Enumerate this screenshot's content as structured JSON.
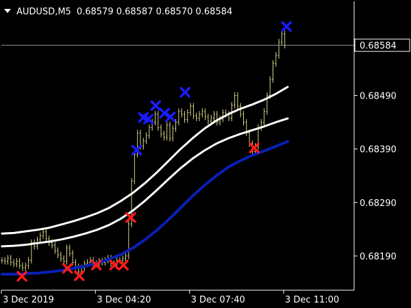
{
  "header": {
    "symbol": "AUDUSD,M5",
    "ohlc": "0.68579 0.68587 0.68570 0.68584"
  },
  "chart_data": {
    "type": "line",
    "title": "AUDUSD,M5  0.68579 0.68587 0.68570 0.68584",
    "current_price": 0.68584,
    "current_price_label": "0.68584",
    "ylim": [
      0.68126,
      0.68666
    ],
    "y_ticks": [
      {
        "value": 0.6849,
        "label": "0.68490"
      },
      {
        "value": 0.6839,
        "label": "0.68390"
      },
      {
        "value": 0.6829,
        "label": "0.68290"
      },
      {
        "value": 0.6819,
        "label": "0.68190"
      }
    ],
    "xlim": [
      0,
      120
    ],
    "x_ticks": [
      {
        "value": 0,
        "label": "3 Dec 2019"
      },
      {
        "value": 32,
        "label": "3 Dec 04:20"
      },
      {
        "value": 64,
        "label": "3 Dec 07:40"
      },
      {
        "value": 96,
        "label": "3 Dec 11:00"
      }
    ],
    "price_close": [
      0.68182,
      0.6818,
      0.68186,
      0.68178,
      0.68175,
      0.6818,
      0.68172,
      0.68168,
      0.68172,
      0.68182,
      0.68215,
      0.68208,
      0.6822,
      0.68228,
      0.68235,
      0.68222,
      0.68215,
      0.6821,
      0.682,
      0.68192,
      0.68185,
      0.6818,
      0.68205,
      0.68195,
      0.68178,
      0.6817,
      0.6816,
      0.68168,
      0.68175,
      0.68178,
      0.68182,
      0.68176,
      0.68175,
      0.6818,
      0.68178,
      0.68182,
      0.68186,
      0.68176,
      0.68176,
      0.68182,
      0.68182,
      0.68185,
      0.6819,
      0.6825,
      0.6833,
      0.6838,
      0.6842,
      0.68395,
      0.68405,
      0.68415,
      0.6843,
      0.6844,
      0.68455,
      0.6843,
      0.68418,
      0.68412,
      0.68435,
      0.6841,
      0.68428,
      0.6844,
      0.6846,
      0.68455,
      0.68445,
      0.68458,
      0.6847,
      0.68452,
      0.68448,
      0.68455,
      0.6846,
      0.6845,
      0.68442,
      0.68448,
      0.68455,
      0.6844,
      0.68446,
      0.68458,
      0.68455,
      0.68448,
      0.68472,
      0.6849,
      0.6847,
      0.68455,
      0.6844,
      0.6842,
      0.684,
      0.68385,
      0.68395,
      0.6843,
      0.6844,
      0.6846,
      0.6849,
      0.6852,
      0.6855,
      0.68565,
      0.6859,
      0.68605,
      0.68584
    ],
    "series": [
      {
        "color": "#ffffff",
        "values": [
          0.68232,
          0.68233,
          0.68236,
          0.68239,
          0.68243,
          0.68249,
          0.68255,
          0.68262,
          0.6827,
          0.6828,
          0.68293,
          0.68308,
          0.68326,
          0.68346,
          0.68368,
          0.6839,
          0.6841,
          0.68428,
          0.68443,
          0.68455,
          0.68465,
          0.68473,
          0.68482,
          0.68493,
          0.68506
        ]
      },
      {
        "color": "#ffffff",
        "values": [
          0.68208,
          0.68209,
          0.68211,
          0.68214,
          0.68217,
          0.68221,
          0.68226,
          0.68232,
          0.68239,
          0.68248,
          0.6826,
          0.68275,
          0.68293,
          0.68313,
          0.68334,
          0.68354,
          0.68372,
          0.68387,
          0.684,
          0.6841,
          0.68418,
          0.68425,
          0.68432,
          0.6844,
          0.68447
        ]
      },
      {
        "color": "#0a1fb8",
        "values": [
          0.68156,
          0.68156,
          0.68157,
          0.68158,
          0.6816,
          0.68163,
          0.68167,
          0.68171,
          0.68177,
          0.68184,
          0.68193,
          0.68205,
          0.6822,
          0.68238,
          0.68258,
          0.6828,
          0.68302,
          0.68322,
          0.6834,
          0.68356,
          0.68368,
          0.68378,
          0.68386,
          0.68395,
          0.68404
        ]
      }
    ],
    "markers_sell": [
      {
        "x": 46.0,
        "y": 0.68388
      },
      {
        "x": 48.3,
        "y": 0.68449
      },
      {
        "x": 50.0,
        "y": 0.68446
      },
      {
        "x": 52.5,
        "y": 0.68471
      },
      {
        "x": 55.5,
        "y": 0.68457
      },
      {
        "x": 57.5,
        "y": 0.6845
      },
      {
        "x": 62.5,
        "y": 0.68496
      },
      {
        "x": 97.0,
        "y": 0.68619
      }
    ],
    "markers_buy": [
      {
        "x": 7.0,
        "y": 0.68152
      },
      {
        "x": 22.5,
        "y": 0.68167
      },
      {
        "x": 26.5,
        "y": 0.68153
      },
      {
        "x": 32.3,
        "y": 0.68173
      },
      {
        "x": 38.5,
        "y": 0.68173
      },
      {
        "x": 41.5,
        "y": 0.68173
      },
      {
        "x": 44.0,
        "y": 0.68262
      },
      {
        "x": 86.0,
        "y": 0.68392
      }
    ],
    "marker_colors": {
      "sell": "#1b1bff",
      "buy": "#ff1a1a"
    },
    "candle_color": "#d8d38a",
    "grid": false,
    "background": "#000000",
    "legend": "none"
  }
}
